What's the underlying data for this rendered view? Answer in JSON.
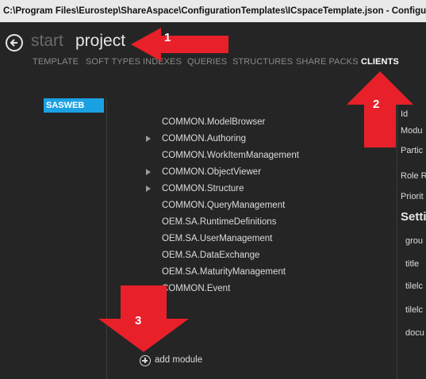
{
  "window": {
    "title": "C:\\Program Files\\Eurostep\\ShareAspace\\ConfigurationTemplates\\ICspaceTemplate.json - Configu"
  },
  "breadcrumb": {
    "start": "start",
    "current": "project"
  },
  "tabs": [
    "TEMPLATE",
    "SOFT TYPES",
    "INDEXES",
    "QUERIES",
    "STRUCTURES",
    "SHARE PACKS",
    "CLIENTS"
  ],
  "active_tab": "CLIENTS",
  "clients": [
    {
      "label": "SASWEB",
      "selected": true
    }
  ],
  "modules": [
    {
      "label": "COMMON.ModelBrowser",
      "expandable": false
    },
    {
      "label": "COMMON.Authoring",
      "expandable": true
    },
    {
      "label": "COMMON.WorkItemManagement",
      "expandable": false
    },
    {
      "label": "COMMON.ObjectViewer",
      "expandable": true
    },
    {
      "label": "COMMON.Structure",
      "expandable": true
    },
    {
      "label": "COMMON.QueryManagement",
      "expandable": false
    },
    {
      "label": "OEM.SA.RuntimeDefinitions",
      "expandable": false
    },
    {
      "label": "OEM.SA.UserManagement",
      "expandable": false
    },
    {
      "label": "OEM.SA.DataExchange",
      "expandable": false
    },
    {
      "label": "OEM.SA.MaturityManagement",
      "expandable": false
    },
    {
      "label": "COMMON.Event",
      "expandable": false
    }
  ],
  "add_module_label": "add module",
  "properties": [
    "Id",
    "Modu",
    "Partic",
    "Role R",
    "Priorit"
  ],
  "settings": {
    "heading": "Setti",
    "items": [
      "grou",
      "title",
      "tilelc",
      "tilelc",
      "docu"
    ]
  },
  "annotations": [
    {
      "number": "1"
    },
    {
      "number": "2"
    },
    {
      "number": "3"
    }
  ],
  "colors": {
    "accent": "#1ba1e2",
    "annotation": "#e8202a",
    "background": "#252525"
  }
}
